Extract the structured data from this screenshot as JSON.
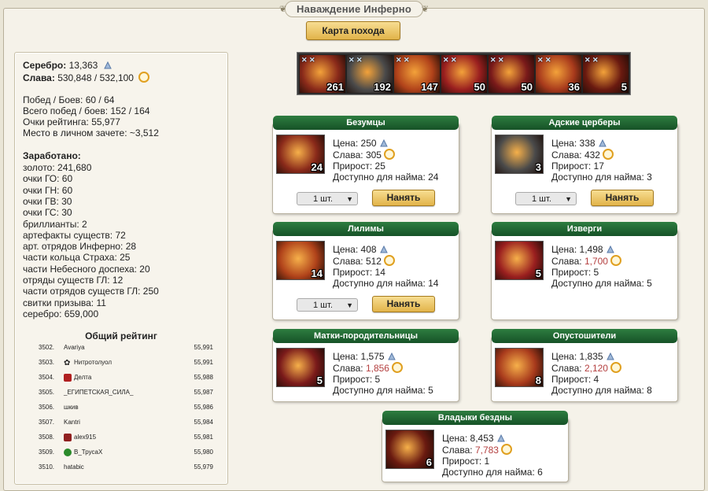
{
  "title": "Наваждение Инферно",
  "map_button": "Карта похода",
  "stats": {
    "silver_label": "Серебро:",
    "silver": "13,363",
    "fame_label": "Слава:",
    "fame": "530,848 / 532,100",
    "wins": "Побед / Боев: 60 / 64",
    "total_wins": "Всего побед / боев: 152 / 164",
    "rating_points": "Очки рейтинга: 55,977",
    "place": "Место в личном зачете: ~3,512"
  },
  "earned": {
    "title": "Заработано:",
    "items": [
      "золото: 241,680",
      "очки ГО: 60",
      "очки ГН: 60",
      "очки ГВ: 30",
      "очки ГС: 30",
      "бриллианты: 2",
      "артефакты существ: 72",
      "арт. отрядов Инферно: 28",
      "части кольца Страха: 25",
      "части Небесного доспеха: 20",
      "отряды существ ГЛ: 12",
      "части отрядов существ ГЛ: 250",
      "свитки призыва: 11",
      "серебро: 659,000"
    ]
  },
  "ranking": {
    "title": "Общий рейтинг",
    "rows": [
      {
        "num": "3502.",
        "name": "Avariya",
        "score": "55,991",
        "icon": ""
      },
      {
        "num": "3503.",
        "name": "Нитротолуол",
        "score": "55,991",
        "icon": "paw-icon"
      },
      {
        "num": "3504.",
        "name": "Делта",
        "score": "55,988",
        "icon": "flag-icon"
      },
      {
        "num": "3505.",
        "name": "_ЕГИПЕТСКАЯ_СИЛА_",
        "score": "55,987",
        "icon": ""
      },
      {
        "num": "3506.",
        "name": "шкив",
        "score": "55,986",
        "icon": ""
      },
      {
        "num": "3507.",
        "name": "Kantri",
        "score": "55,984",
        "icon": ""
      },
      {
        "num": "3508.",
        "name": "alex915",
        "score": "55,981",
        "icon": "clan-icon"
      },
      {
        "num": "3509.",
        "name": "B_ТрусаХ",
        "score": "55,980",
        "icon": "leaf-icon"
      },
      {
        "num": "3510.",
        "name": "hatabic",
        "score": "55,979",
        "icon": ""
      }
    ]
  },
  "army": [
    {
      "count": "261",
      "color": "#8a2a1a"
    },
    {
      "count": "192",
      "color": "#4a4a4a"
    },
    {
      "count": "147",
      "color": "#b0421a"
    },
    {
      "count": "50",
      "color": "#9a1f1f"
    },
    {
      "count": "50",
      "color": "#7a1a1a"
    },
    {
      "count": "36",
      "color": "#a83a1c"
    },
    {
      "count": "5",
      "color": "#6a1a10"
    }
  ],
  "labels": {
    "price": "Цена:",
    "fame": "Слава:",
    "growth": "Прирост:",
    "available": "Доступно для найма:",
    "qty": "1 шт.",
    "hire": "Нанять"
  },
  "cards": [
    {
      "name": "Безумцы",
      "count": "24",
      "price": "250",
      "fame": "305",
      "fame_red": false,
      "growth": "25",
      "available": "24",
      "hire": true,
      "color": "#8a2a1a"
    },
    {
      "name": "Адские церберы",
      "count": "3",
      "price": "338",
      "fame": "432",
      "fame_red": false,
      "growth": "17",
      "available": "3",
      "hire": true,
      "color": "#4a4a4a"
    },
    {
      "name": "Лилимы",
      "count": "14",
      "price": "408",
      "fame": "512",
      "fame_red": false,
      "growth": "14",
      "available": "14",
      "hire": true,
      "color": "#b0421a"
    },
    {
      "name": "Изверги",
      "count": "5",
      "price": "1,498",
      "fame": "1,700",
      "fame_red": true,
      "growth": "5",
      "available": "5",
      "hire": false,
      "color": "#9a1f1f"
    },
    {
      "name": "Матки-породительницы",
      "count": "5",
      "price": "1,575",
      "fame": "1,856",
      "fame_red": true,
      "growth": "5",
      "available": "5",
      "hire": false,
      "color": "#7a1a1a"
    },
    {
      "name": "Опустошители",
      "count": "8",
      "price": "1,835",
      "fame": "2,120",
      "fame_red": true,
      "growth": "4",
      "available": "8",
      "hire": false,
      "color": "#a83a1c"
    },
    {
      "name": "Владыки бездны",
      "count": "6",
      "price": "8,453",
      "fame": "7,783",
      "fame_red": true,
      "growth": "1",
      "available": "6",
      "hire": false,
      "color": "#6a1a10"
    }
  ]
}
